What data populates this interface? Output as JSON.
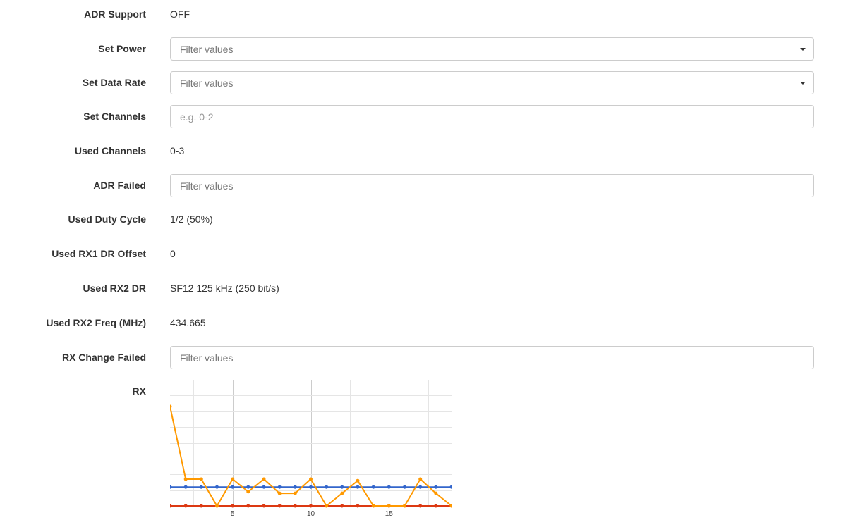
{
  "fields": {
    "adr_support": {
      "label": "ADR Support",
      "value": "OFF"
    },
    "set_power": {
      "label": "Set Power",
      "placeholder": "Filter values"
    },
    "set_data_rate": {
      "label": "Set Data Rate",
      "placeholder": "Filter values"
    },
    "set_channels": {
      "label": "Set Channels",
      "placeholder": "e.g. 0-2"
    },
    "used_channels": {
      "label": "Used Channels",
      "value": "0-3"
    },
    "adr_failed": {
      "label": "ADR Failed",
      "placeholder": "Filter values"
    },
    "used_duty_cycle": {
      "label": "Used Duty Cycle",
      "value": "1/2 (50%)"
    },
    "used_rx1_dr_offset": {
      "label": "Used RX1 DR Offset",
      "value": "0"
    },
    "used_rx2_dr": {
      "label": "Used RX2 DR",
      "value": "SF12 125 kHz (250 bit/s)"
    },
    "used_rx2_freq": {
      "label": "Used RX2 Freq (MHz)",
      "value": "434.665"
    },
    "rx_change_failed": {
      "label": "RX Change Failed",
      "placeholder": "Filter values"
    },
    "rx": {
      "label": "RX"
    }
  },
  "colors": {
    "orange": "#ff9900",
    "blue": "#3366cc",
    "red": "#dc3912",
    "grid": "#cccccc",
    "grid_light": "#e5e5e5"
  },
  "chart_data": {
    "type": "line",
    "x": [
      1,
      2,
      3,
      4,
      5,
      6,
      7,
      8,
      9,
      10,
      11,
      12,
      13,
      14,
      15,
      16,
      17,
      18,
      19
    ],
    "xlim": [
      1,
      19
    ],
    "ylim": [
      0,
      8
    ],
    "x_ticks": [
      "5",
      "10",
      "15"
    ],
    "x_tick_values": [
      5,
      10,
      15
    ],
    "grid": true,
    "series": [
      {
        "color": "#ff9900",
        "values": [
          6.3,
          1.7,
          1.7,
          0.0,
          1.7,
          0.9,
          1.7,
          0.8,
          0.8,
          1.7,
          0.0,
          0.8,
          1.6,
          0.0,
          0.0,
          0.0,
          1.7,
          0.8,
          0.0
        ]
      },
      {
        "color": "#3366cc",
        "values": [
          1.2,
          1.2,
          1.2,
          1.2,
          1.2,
          1.2,
          1.2,
          1.2,
          1.2,
          1.2,
          1.2,
          1.2,
          1.2,
          1.2,
          1.2,
          1.2,
          1.2,
          1.2,
          1.2
        ]
      },
      {
        "color": "#dc3912",
        "values": [
          0,
          0,
          0,
          0,
          0,
          0,
          0,
          0,
          0,
          0,
          0,
          0,
          0,
          0,
          0,
          0,
          0,
          0,
          0
        ]
      }
    ]
  }
}
